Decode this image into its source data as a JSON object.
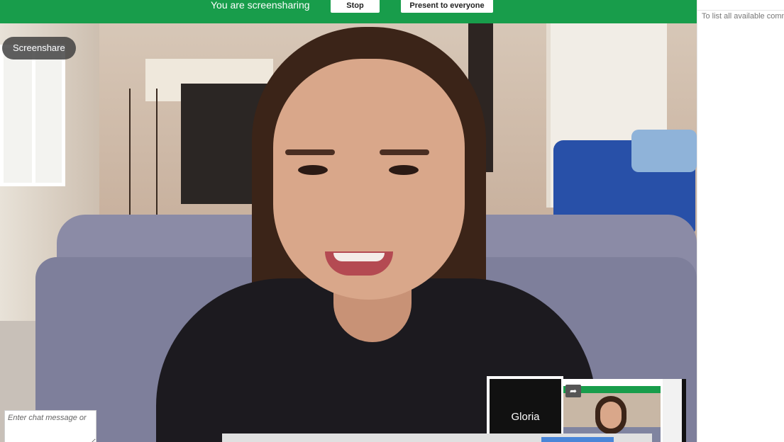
{
  "share_banner": {
    "status_text": "You are screensharing",
    "stop_label": "Stop",
    "present_label": "Present to everyone",
    "color": "#189d4b"
  },
  "main_video": {
    "badge_label": "Screenshare"
  },
  "filmstrip": {
    "participant_name": "Gloria",
    "share_icon": "share-arrow-icon"
  },
  "chat": {
    "hint_text": "To list all available comm",
    "input_placeholder": "Enter chat message or"
  }
}
